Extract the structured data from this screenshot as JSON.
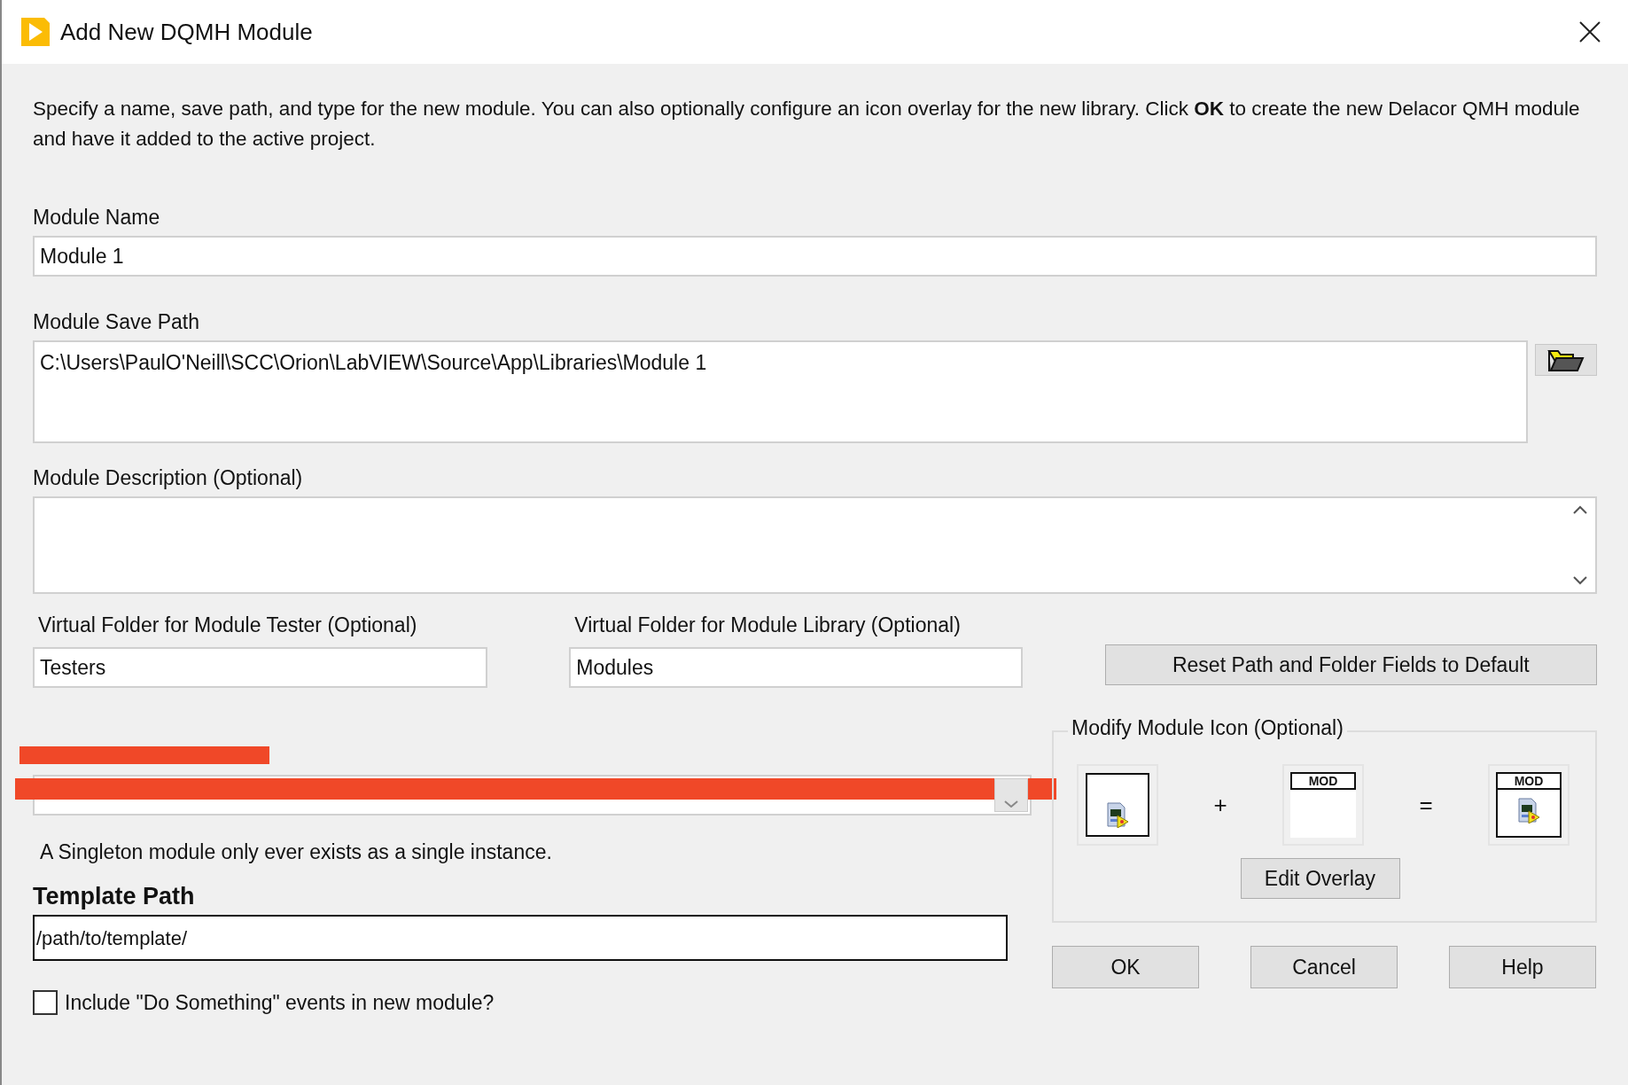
{
  "window": {
    "title": "Add New DQMH Module"
  },
  "instructions": "Specify a name, save path, and type for the new module. You can also optionally configure an icon overlay for the new library. Click **OK** to create the new Delacor QMH module and have it added to the active project.",
  "module_name": {
    "label": "Module Name",
    "value": "Module 1"
  },
  "save_path": {
    "label": "Module Save Path",
    "value": "C:\\Users\\PaulO'Neill\\SCC\\Orion\\LabVIEW\\Source\\App\\Libraries\\Module 1"
  },
  "description": {
    "label": "Module Description (Optional)"
  },
  "tester_folder": {
    "label": "Virtual Folder for Module Tester (Optional)",
    "value": "Testers"
  },
  "library_folder": {
    "label": "Virtual Folder for Module Library (Optional)",
    "value": "Modules"
  },
  "reset_button": "Reset Path and Folder Fields to Default",
  "type_note": "A Singleton module only ever exists as a single instance.",
  "template_path": {
    "label": "Template Path",
    "value": "/path/to/template/"
  },
  "include_events": {
    "label": "Include \"Do Something\" events in new module?",
    "checked": false
  },
  "icon_group": {
    "title": "Modify Module Icon (Optional)",
    "plus": "+",
    "equals": "=",
    "overlay_text": "MOD",
    "result_overlay_text": "MOD",
    "edit_button": "Edit Overlay"
  },
  "buttons": [
    "OK",
    "Cancel",
    "Help"
  ]
}
